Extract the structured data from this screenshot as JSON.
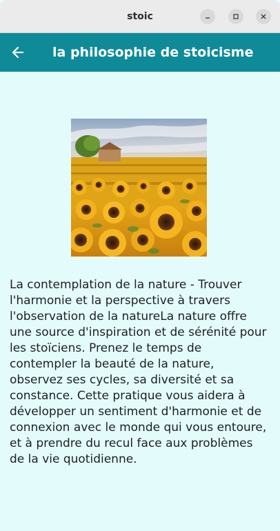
{
  "window": {
    "title": "stoic",
    "controls": {
      "minimize_icon": "minimize-icon",
      "maximize_icon": "maximize-icon",
      "close_icon": "close-icon"
    }
  },
  "appbar": {
    "title": "la philosophie de stoicisme",
    "back_icon": "arrow-back-icon",
    "color": "#0f8a99"
  },
  "content": {
    "image_subject": "sunflower field painting",
    "text": "La contemplation de la nature - Trouver l'harmonie et la perspective à travers l'observation de la natureLa nature offre une source d'inspiration et de sérénité pour les stoïciens. Prenez le temps de contempler la beauté de la nature, observez ses cycles, sa diversité et sa constance. Cette pratique vous aidera à développer un sentiment d'harmonie et de connexion avec le monde qui vous entoure, et à prendre du recul face aux problèmes de la vie quotidienne."
  },
  "colors": {
    "background": "#e4fbfc",
    "titlebar": "#ebebeb"
  }
}
